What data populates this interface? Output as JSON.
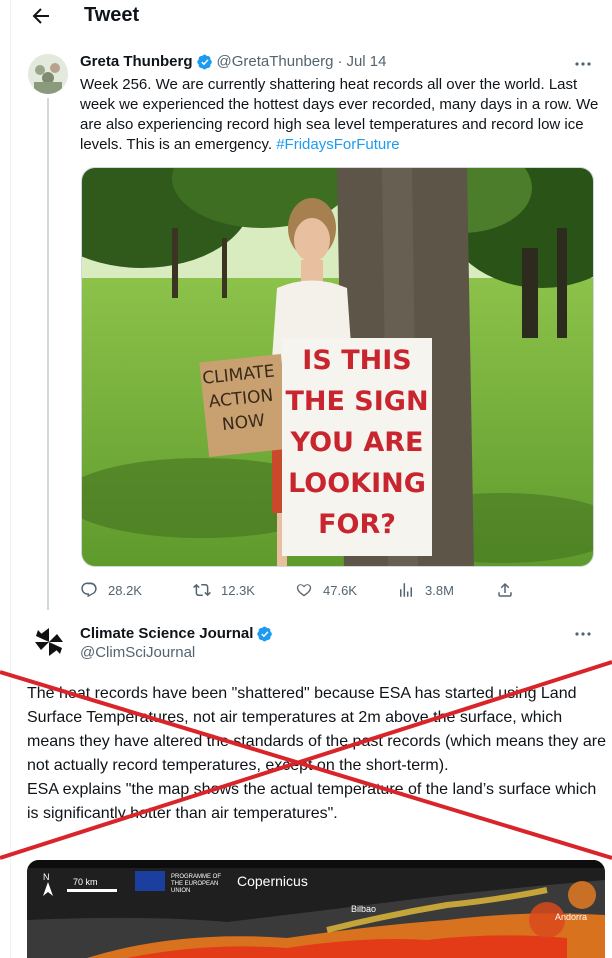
{
  "header": {
    "title": "Tweet",
    "back_icon": "arrow-left-icon"
  },
  "tweet1": {
    "name": "Greta Thunberg",
    "handle": "@GretaThunberg",
    "separator": "·",
    "date": "Jul 14",
    "text": "Week 256. We are currently shattering heat records all over the world. Last week we experienced the hottest days ever recorded, many days in a row. We are also experiencing record high sea level temperatures and record low ice levels. This is an emergency. ",
    "hashtag": "#FridaysForFuture",
    "photo": {
      "sign_small_lines": [
        "CLIMATE",
        "ACTION",
        "NOW"
      ],
      "sign_large_lines": [
        "IS THIS",
        "THE SIGN",
        "YOU ARE",
        "LOOKING",
        "FOR?"
      ]
    },
    "actions": {
      "replies": "28.2K",
      "retweets": "12.3K",
      "likes": "47.6K",
      "views": "3.8M"
    }
  },
  "tweet2": {
    "name": "Climate Science Journal",
    "handle": "@ClimSciJournal",
    "paragraph1": "The heat records have been \"shattered\" because ESA has started using Land Surface Temperatures, not air temperatures at 2m above the surface, which means they have altered the standards of the past records (which means they are not actually record temperatures, except on the short-term).",
    "paragraph2": "ESA explains \"the map shows the actual temperature of the land’s surface which is significantly hotter than air temperatures\".",
    "map": {
      "scale": "70 km",
      "north": "N",
      "programme": "PROGRAMME OF THE EUROPEAN UNION",
      "logo_text": "Copernicus",
      "city1": "Bilbao",
      "city2": "Andorra"
    }
  },
  "colors": {
    "accent": "#1d9bf0",
    "secondary_text": "#536471",
    "cross_red": "#d9252a",
    "sign_red": "#c8252e"
  }
}
